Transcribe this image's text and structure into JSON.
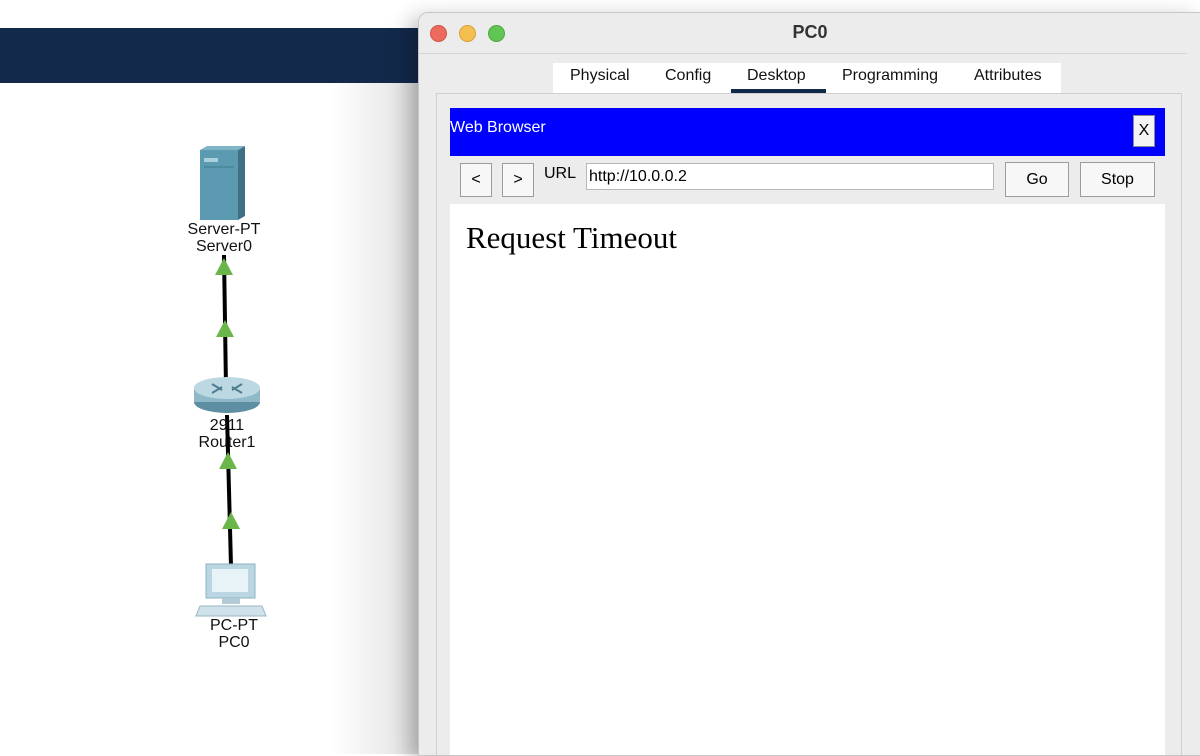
{
  "window": {
    "title": "PC0",
    "tabs": [
      "Physical",
      "Config",
      "Desktop",
      "Programming",
      "Attributes"
    ],
    "active_tab": "Desktop"
  },
  "browser": {
    "title": "Web Browser",
    "close_label": "X",
    "back_label": "<",
    "forward_label": ">",
    "url_label": "URL",
    "url_value": "http://10.0.0.2",
    "go_label": "Go",
    "stop_label": "Stop",
    "content_text": "Request Timeout"
  },
  "topology": {
    "server": {
      "model": "Server-PT",
      "name": "Server0"
    },
    "router": {
      "model": "2911",
      "name": "Router1"
    },
    "pc": {
      "model": "PC-PT",
      "name": "PC0"
    }
  },
  "colors": {
    "header_bar": "#13294b",
    "browser_title_bar": "#0000ff",
    "link_ok": "#6ab64a"
  }
}
